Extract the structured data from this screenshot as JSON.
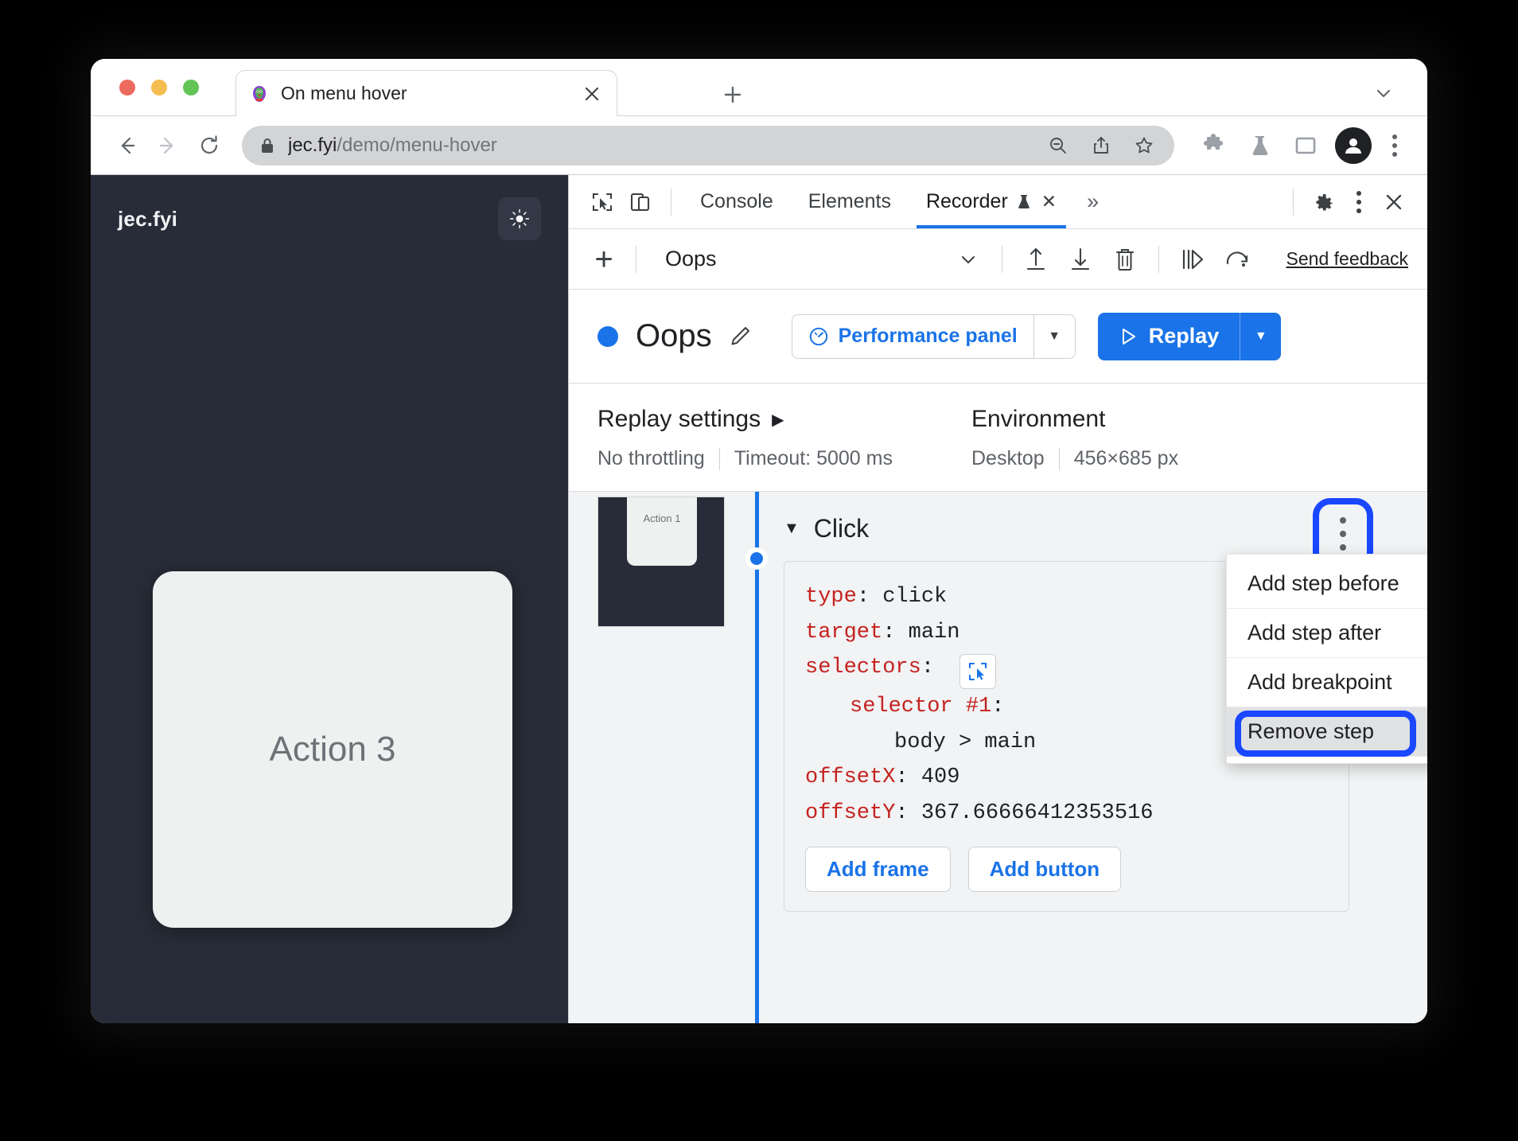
{
  "browser": {
    "tab": {
      "title": "On menu hover",
      "favicon_icon": "parrot-favicon",
      "close_icon": "close-icon"
    },
    "newtab_label": "+",
    "tablist_chevron_icon": "chevron-down-icon",
    "nav": {
      "back_icon": "arrow-left-icon",
      "forward_icon": "arrow-right-icon",
      "reload_icon": "reload-icon"
    },
    "omnibox": {
      "lock_icon": "lock-icon",
      "url_host": "jec.fyi",
      "url_path": "/demo/menu-hover",
      "zoom_out_icon": "zoom-out-icon",
      "share_icon": "share-icon",
      "bookmark_icon": "star-icon"
    },
    "toolbar": {
      "extensions_icon": "puzzle-icon",
      "experiments_icon": "flask-icon",
      "side_panel_icon": "side-panel-icon",
      "profile_icon": "avatar-icon",
      "menu_icon": "three-dot-menu-icon"
    }
  },
  "page_preview": {
    "brand": "jec.fyi",
    "theme_toggle_icon": "sun-icon",
    "card_label": "Action 3"
  },
  "devtools": {
    "inspect_icon": "inspect-cursor-icon",
    "device_toolbar_icon": "device-toolbar-icon",
    "tabs": [
      {
        "label": "Console",
        "active": false
      },
      {
        "label": "Elements",
        "active": false
      },
      {
        "label": "Recorder",
        "active": true,
        "badge_icon": "flask-icon",
        "close_icon": "close-icon"
      }
    ],
    "more_tabs_icon": "chevron-double-right-icon",
    "settings_icon": "gear-icon",
    "menu_icon": "three-dot-menu-icon",
    "close_icon": "close-icon",
    "accent_color": "#1a73e8"
  },
  "recorder": {
    "toolbar": {
      "add_icon": "plus-icon",
      "recording_name": "Oops",
      "select_chevron_icon": "chevron-down-icon",
      "import_icon": "upload-icon",
      "export_icon": "download-icon",
      "delete_icon": "trash-icon",
      "step_over_icon": "step-over-icon",
      "replay_again_icon": "replay-again-icon",
      "feedback_label": "Send feedback"
    },
    "header": {
      "status_dot_color": "#1a73e8",
      "title": "Oops",
      "edit_icon": "pencil-icon",
      "performance_label": "Performance panel",
      "performance_icon": "perf-gauge-icon",
      "performance_chevron_icon": "chevron-down-icon",
      "replay_label": "Replay",
      "replay_icon": "play-triangle-icon",
      "replay_chevron_icon": "chevron-down-icon"
    },
    "settings": {
      "replay_settings_title": "Replay settings",
      "replay_settings_caret_icon": "triangle-right-icon",
      "throttling": "No throttling",
      "timeout": "Timeout: 5000 ms",
      "environment_title": "Environment",
      "device": "Desktop",
      "viewport": "456×685 px"
    },
    "timeline": {
      "thumbnail_label": "Action 1",
      "rail_color": "#1a73e8"
    },
    "step": {
      "caret_icon": "caret-down-icon",
      "title": "Click",
      "kebab_icon": "three-dot-menu-icon",
      "code": [
        {
          "key": "type",
          "sep": ": ",
          "value": "click",
          "indent": 0
        },
        {
          "key": "target",
          "sep": ": ",
          "value": "main",
          "indent": 0
        },
        {
          "key": "selectors",
          "sep": ": ",
          "value": "",
          "indent": 0,
          "picker_icon": "selector-picker-icon"
        },
        {
          "key": "selector #1",
          "sep": ":",
          "value": "",
          "indent": 1
        },
        {
          "key": "",
          "sep": "",
          "value": "body > main",
          "indent": 2
        },
        {
          "key": "offsetX",
          "sep": ": ",
          "value": "409",
          "indent": 0
        },
        {
          "key": "offsetY",
          "sep": ": ",
          "value": "367.66666412353516",
          "indent": 0
        }
      ],
      "add_frame_label": "Add frame",
      "add_button_label": "Add button"
    },
    "context_menu": {
      "items": [
        {
          "label": "Add step before",
          "selected": false
        },
        {
          "label": "Add step after",
          "selected": false
        },
        {
          "label": "Add breakpoint",
          "selected": false
        },
        {
          "label": "Remove step",
          "selected": true
        }
      ],
      "highlight_color": "#1a47ff"
    }
  }
}
